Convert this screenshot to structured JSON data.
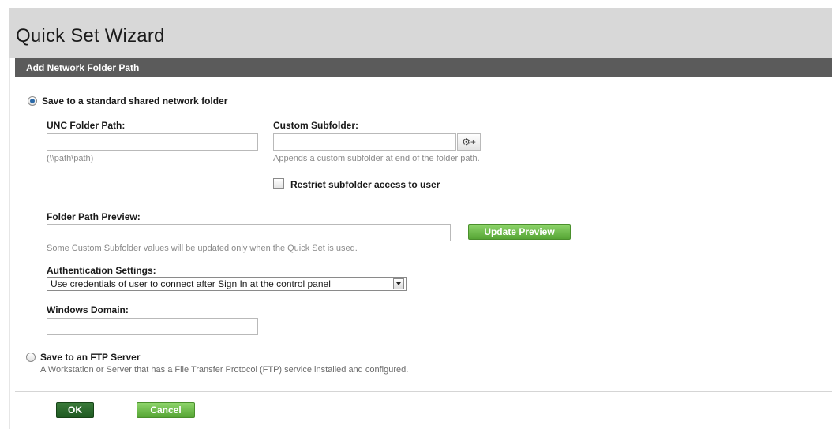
{
  "window": {
    "title": "Quick Set Wizard"
  },
  "section": {
    "title": "Add Network Folder Path"
  },
  "options": {
    "shared_folder": {
      "label": "Save to a standard shared network folder",
      "selected": true
    },
    "ftp": {
      "label": "Save to an FTP Server",
      "description": "A Workstation or Server that has a File Transfer Protocol (FTP) service installed and configured.",
      "selected": false
    }
  },
  "unc": {
    "label": "UNC Folder Path:",
    "value": "",
    "hint": "(\\\\path\\path)"
  },
  "subfolder": {
    "label": "Custom Subfolder:",
    "value": "",
    "hint": "Appends a custom subfolder at end of the folder path.",
    "gear_button_label": "⚙+"
  },
  "restrict": {
    "label": "Restrict subfolder access to user",
    "checked": false
  },
  "preview": {
    "label": "Folder Path Preview:",
    "value": "",
    "hint": "Some Custom Subfolder values will be updated only when the Quick Set is used.",
    "button_label": "Update Preview"
  },
  "auth": {
    "label": "Authentication Settings:",
    "selected_value": "Use credentials of user to connect after Sign In at the control panel"
  },
  "domain": {
    "label": "Windows Domain:",
    "value": ""
  },
  "footer": {
    "ok_label": "OK",
    "cancel_label": "Cancel"
  },
  "colors": {
    "section_bar": "#5b5b5b",
    "header_bg": "#d8d8d8",
    "button_green": "#6cbf48",
    "button_dark_green": "#2a6a2c",
    "radio_selected": "#2b6aa8"
  },
  "icons": {
    "gear": "gear-plus-icon",
    "dropdown": "chevron-down-icon"
  }
}
